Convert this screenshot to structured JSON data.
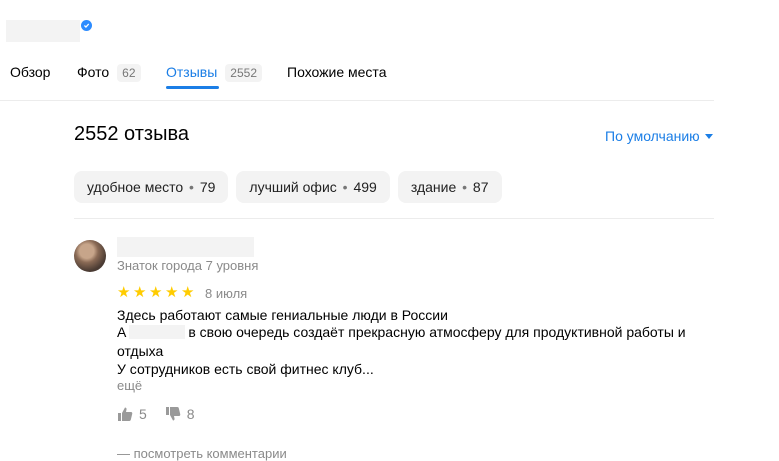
{
  "tabs": [
    {
      "label": "Обзор",
      "count": null
    },
    {
      "label": "Фото",
      "count": "62"
    },
    {
      "label": "Отзывы",
      "count": "2552"
    },
    {
      "label": "Похожие места",
      "count": null
    }
  ],
  "reviews": {
    "heading": "2552 отзыва",
    "sort_label": "По умолчанию",
    "chips": [
      {
        "label": "удобное место",
        "count": "79"
      },
      {
        "label": "лучший офис",
        "count": "499"
      },
      {
        "label": "здание",
        "count": "87"
      }
    ]
  },
  "review": {
    "author_level": "Знаток города 7 уровня",
    "rating": 5,
    "date": "8 июля",
    "line1": "Здесь работают самые гениальные люди в России",
    "line2_start": "А",
    "line2_end": "в свою очередь создаёт прекрасную атмосферу для продуктивной работы и",
    "line3": "отдыха",
    "line4": "У сотрудников есть свой фитнес клуб...",
    "more": "ещё",
    "likes": "5",
    "dislikes": "8",
    "comments_link": "— посмотреть комментарии"
  },
  "colors": {
    "accent": "#1b7ee6",
    "star": "#ffcc00"
  }
}
